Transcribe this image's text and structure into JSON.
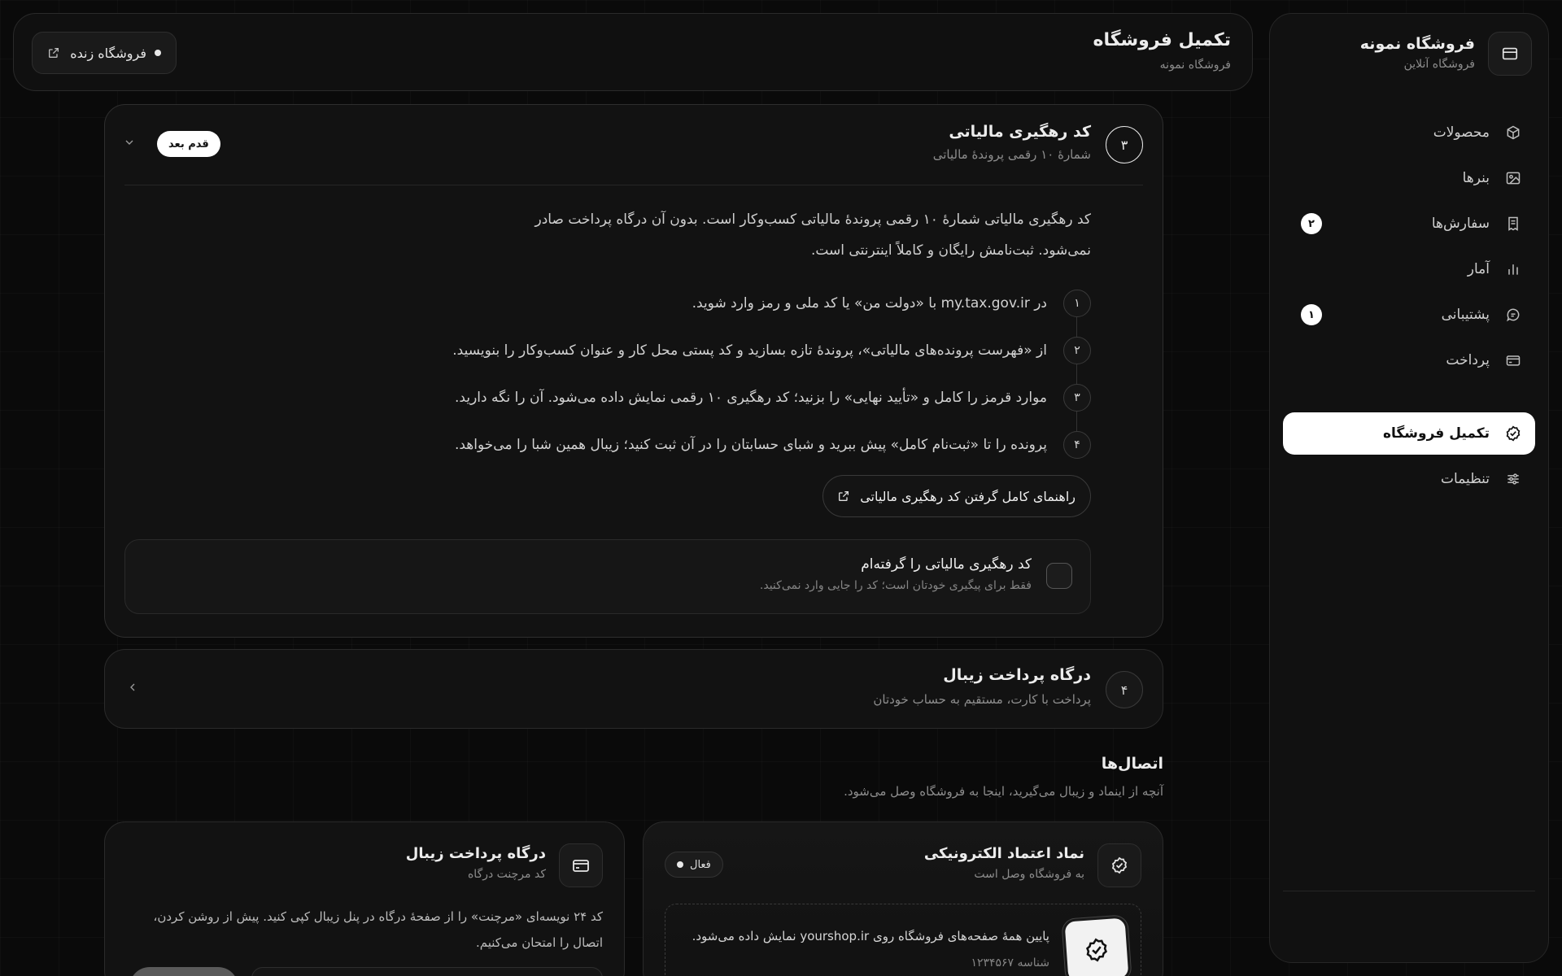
{
  "sidebar": {
    "brand_title": "فروشگاه نمونه",
    "brand_subtitle": "فروشگاه آنلاین",
    "items": [
      {
        "label": "محصولات",
        "icon": "box-icon"
      },
      {
        "label": "بنرها",
        "icon": "image-icon"
      },
      {
        "label": "سفارش‌ها",
        "icon": "receipt-icon",
        "badge": "۲"
      },
      {
        "label": "آمار",
        "icon": "bar-chart-icon"
      },
      {
        "label": "پشتیبانی",
        "icon": "chat-icon",
        "badge": "۱"
      },
      {
        "label": "پرداخت",
        "icon": "credit-card-icon"
      },
      {
        "label": "تکمیل فروشگاه",
        "icon": "badge-check-icon",
        "active": true
      },
      {
        "label": "تنظیمات",
        "icon": "sliders-icon"
      }
    ]
  },
  "header": {
    "title": "تکمیل فروشگاه",
    "subtitle": "فروشگاه نمونه",
    "live_store_label": "فروشگاه زنده"
  },
  "step3": {
    "number": "۳",
    "title": "کد رهگیری مالیاتی",
    "subtitle": "شمارهٔ ۱۰ رقمی پروندهٔ مالیاتی",
    "next_badge": "قدم بعد",
    "intro": "کد رهگیری مالیاتی شمارهٔ ۱۰ رقمی پروندهٔ مالیاتی کسب‌وکار است. بدون آن درگاه پرداخت صادر نمی‌شود. ثبت‌نامش رایگان و کاملاً اینترنتی است.",
    "steps": [
      {
        "num": "۱",
        "text": "در my.tax.gov.ir با «دولت من» یا کد ملی و رمز وارد شوید."
      },
      {
        "num": "۲",
        "text": "از «فهرست پرونده‌های مالیاتی»، پروندهٔ تازه بسازید و کد پستی محل کار و عنوان کسب‌وکار را بنویسید."
      },
      {
        "num": "۳",
        "text": "موارد قرمز را کامل و «تأیید نهایی» را بزنید؛ کد رهگیری ۱۰ رقمی نمایش داده می‌شود. آن را نگه دارید."
      },
      {
        "num": "۴",
        "text": "پرونده را تا «ثبت‌نام کامل» پیش ببرید و شبای حسابتان را در آن ثبت کنید؛ زیبال همین شبا را می‌خواهد."
      }
    ],
    "guide_button": "راهنمای کامل گرفتن کد رهگیری مالیاتی",
    "confirm_title": "کد رهگیری مالیاتی را گرفته‌ام",
    "confirm_subtitle": "فقط برای پیگیری خودتان است؛ کد را جایی وارد نمی‌کنید."
  },
  "step4": {
    "number": "۴",
    "title": "درگاه پرداخت زیبال",
    "subtitle": "پرداخت با کارت، مستقیم به حساب خودتان"
  },
  "connections": {
    "title": "اتصال‌ها",
    "subtitle": "آنچه از اینماد و زیبال می‌گیرید، اینجا به فروشگاه وصل می‌شود.",
    "enamad": {
      "title": "نماد اعتماد الکترونیکی",
      "subtitle": "به فروشگاه وصل است",
      "status": "فعال",
      "display_text": "پایین همهٔ صفحه‌های فروشگاه روی yourshop.ir نمایش داده می‌شود.",
      "id_text": "شناسه ۱۲۳۴۵۶۷"
    },
    "gateway": {
      "title": "درگاه پرداخت زیبال",
      "subtitle": "کد مرچنت درگاه",
      "description": "کد ۲۴ نویسه‌ای «مرچنت» را از صفحهٔ درگاه در پنل زیبال کپی کنید. پیش از روشن کردن، اتصال را امتحان می‌کنیم."
    }
  }
}
